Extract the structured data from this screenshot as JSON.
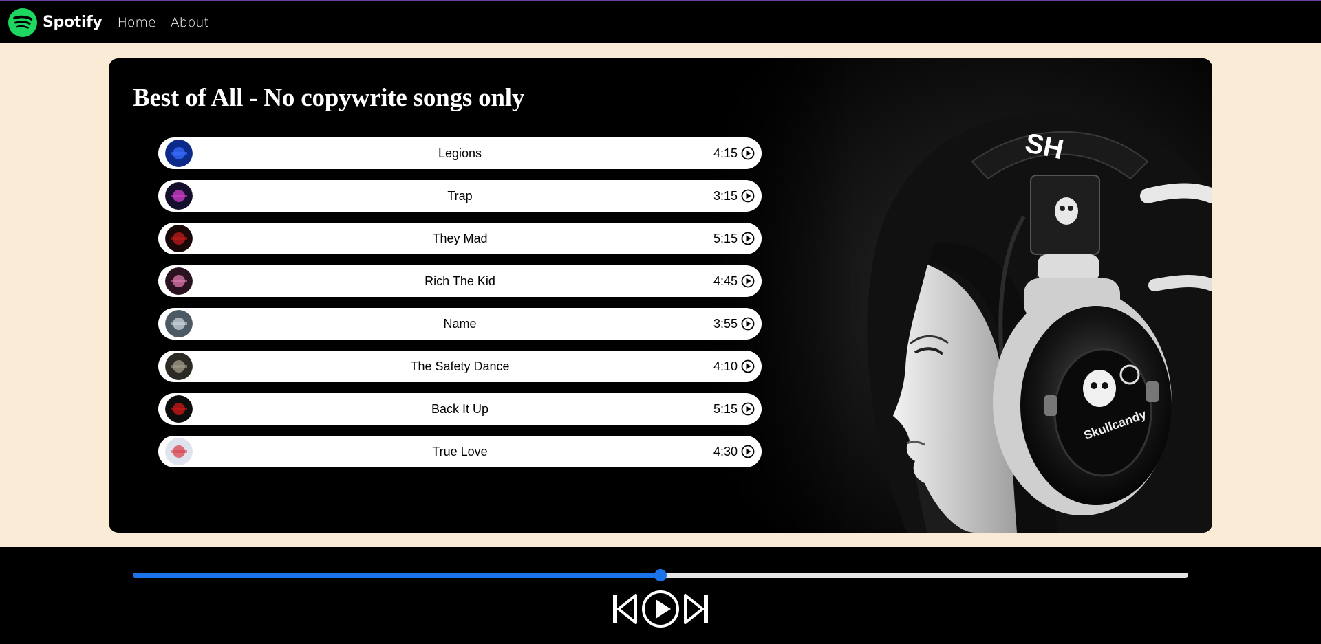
{
  "navbar": {
    "brand": "Spotify",
    "brand_icon": "spotify-logo-icon",
    "brand_color": "#1ed760",
    "links": [
      "Home",
      "About"
    ]
  },
  "playlist": {
    "title": "Best of All - No copywrite songs only",
    "songs": [
      {
        "title": "Legions",
        "duration": "4:15",
        "cover_color": "#0b2a8a",
        "cover_accent": "#3a6cff"
      },
      {
        "title": "Trap",
        "duration": "3:15",
        "cover_color": "#140f2a",
        "cover_accent": "#d23fd0"
      },
      {
        "title": "They Mad",
        "duration": "5:15",
        "cover_color": "#1a0808",
        "cover_accent": "#c01a1a"
      },
      {
        "title": "Rich The Kid",
        "duration": "4:45",
        "cover_color": "#2a1220",
        "cover_accent": "#e07ab0"
      },
      {
        "title": "Name",
        "duration": "3:55",
        "cover_color": "#4d5a63",
        "cover_accent": "#c9d3d9"
      },
      {
        "title": "The Safety Dance",
        "duration": "4:10",
        "cover_color": "#2c2a24",
        "cover_accent": "#a39e8a"
      },
      {
        "title": "Back It Up",
        "duration": "5:15",
        "cover_color": "#0d0d0d",
        "cover_accent": "#d01818"
      },
      {
        "title": "True Love",
        "duration": "4:30",
        "cover_color": "#dfe3ee",
        "cover_accent": "#d8454f"
      }
    ]
  },
  "player": {
    "progress": 0.5,
    "accent": "#1a73e8",
    "controls": [
      "previous-icon",
      "play-icon",
      "next-icon"
    ]
  }
}
